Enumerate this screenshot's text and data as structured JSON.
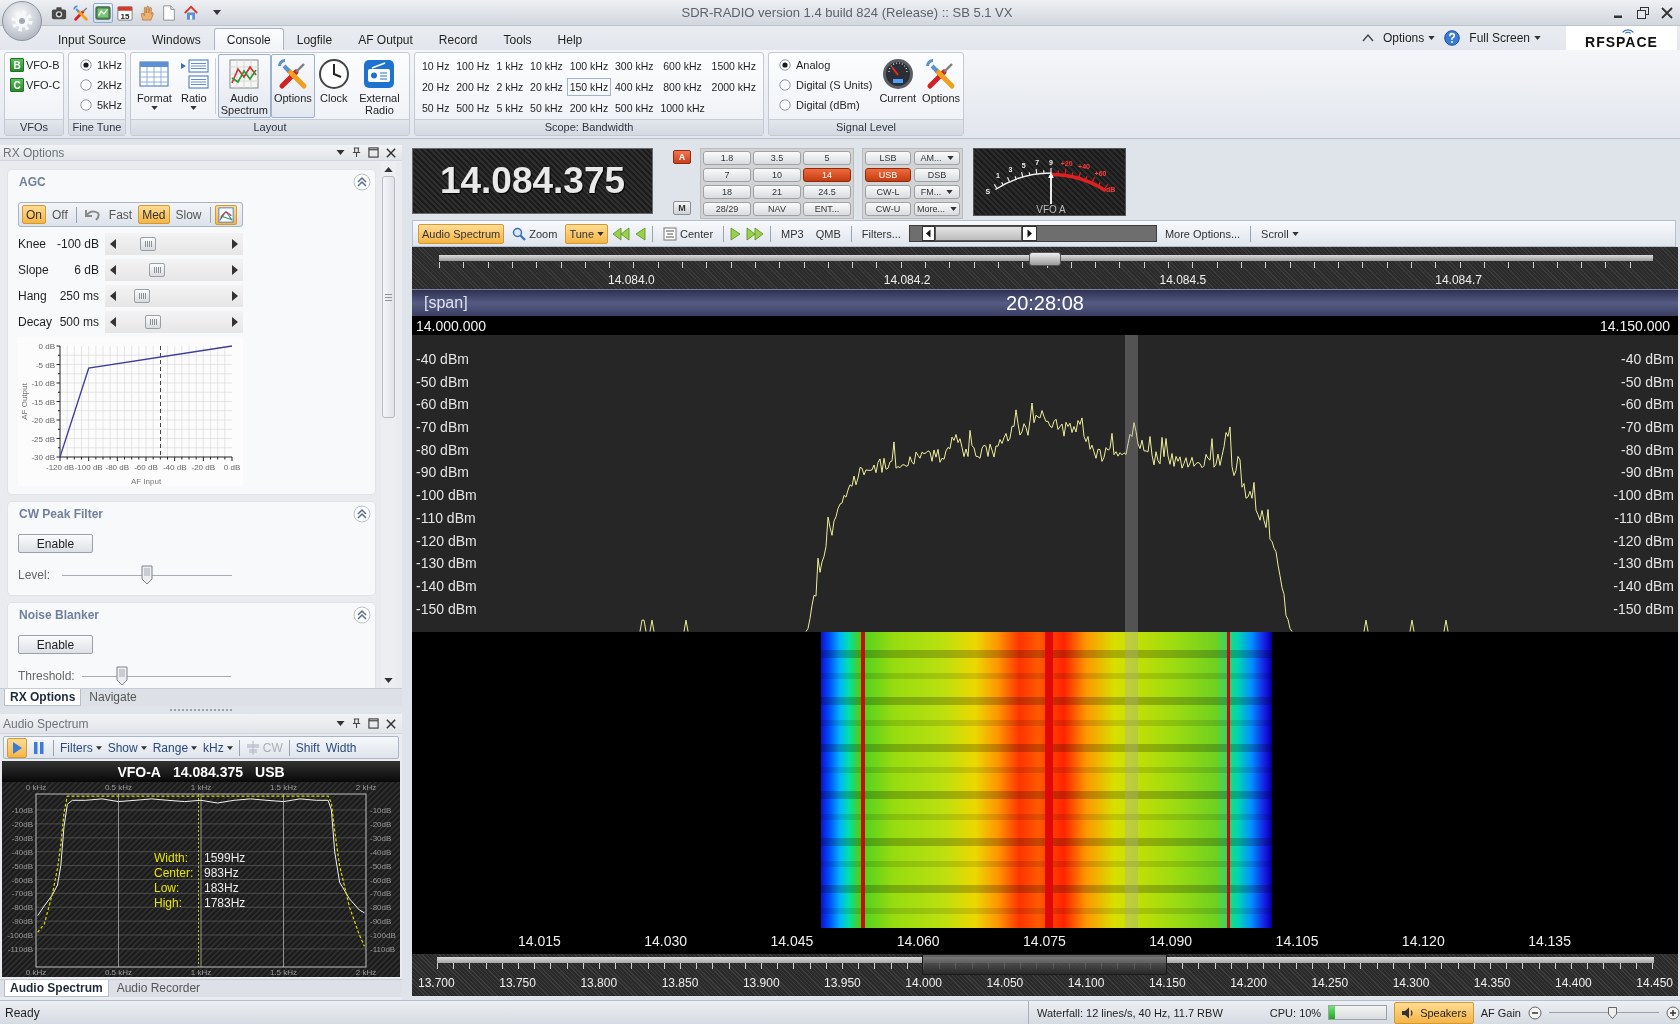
{
  "window": {
    "title": "SDR-RADIO version 1.4 build 824 (Release) :: SB 5.1 VX"
  },
  "quick_access": {
    "buttons": [
      {
        "selected": false
      },
      {
        "selected": false
      },
      {
        "selected": true
      },
      {
        "selected": false
      },
      {
        "selected": false
      },
      {
        "selected": false
      },
      {
        "selected": false
      }
    ],
    "calendar_day": "15"
  },
  "ribbon_tabs": [
    {
      "label": "Input Source",
      "selected": false
    },
    {
      "label": "Windows",
      "selected": false
    },
    {
      "label": "Console",
      "selected": true
    },
    {
      "label": "Logfile",
      "selected": false
    },
    {
      "label": "AF Output",
      "selected": false
    },
    {
      "label": "Record",
      "selected": false
    },
    {
      "label": "Tools",
      "selected": false
    },
    {
      "label": "Help",
      "selected": false
    }
  ],
  "ribbon_menus": [
    {
      "label": "Options"
    },
    {
      "label": "Full Screen"
    }
  ],
  "logo": {
    "text": "RFSPACE"
  },
  "ribbon": {
    "vfos": {
      "label": "VFOs",
      "items": [
        {
          "badge": "B",
          "label": "VFO-B"
        },
        {
          "badge": "C",
          "label": "VFO-C"
        }
      ]
    },
    "fine_tune": {
      "label": "Fine Tune",
      "options": [
        {
          "label": "1kHz",
          "selected": true
        },
        {
          "label": "2kHz",
          "selected": false
        },
        {
          "label": "5kHz",
          "selected": false
        }
      ]
    },
    "layout": {
      "label": "Layout",
      "buttons": [
        {
          "label": "Format",
          "dropdown": true,
          "selected": false
        },
        {
          "label": "Ratio",
          "dropdown": true,
          "selected": false
        },
        {
          "label": "Audio Spectrum",
          "dropdown": false,
          "selected": true
        },
        {
          "label": "Options",
          "dropdown": false,
          "selected": true
        },
        {
          "label": "Clock",
          "dropdown": false,
          "selected": false
        },
        {
          "label": "External Radio",
          "dropdown": false,
          "selected": false
        }
      ]
    },
    "scope_bandwidth": {
      "label": "Scope: Bandwidth",
      "rows": [
        [
          {
            "label": "10 Hz",
            "selected": false
          },
          {
            "label": "100 Hz",
            "selected": false
          },
          {
            "label": "1 kHz",
            "selected": false
          },
          {
            "label": "10 kHz",
            "selected": false
          },
          {
            "label": "100 kHz",
            "selected": false
          },
          {
            "label": "300 kHz",
            "selected": false
          },
          {
            "label": "600 kHz",
            "selected": false
          },
          {
            "label": "1500 kHz",
            "selected": false
          }
        ],
        [
          {
            "label": "20 Hz",
            "selected": false
          },
          {
            "label": "200 Hz",
            "selected": false
          },
          {
            "label": "2 kHz",
            "selected": false
          },
          {
            "label": "20 kHz",
            "selected": false
          },
          {
            "label": "150 kHz",
            "selected": true
          },
          {
            "label": "400 kHz",
            "selected": false
          },
          {
            "label": "800 kHz",
            "selected": false
          },
          {
            "label": "2000 kHz",
            "selected": false
          }
        ],
        [
          {
            "label": "50 Hz",
            "selected": false
          },
          {
            "label": "500 Hz",
            "selected": false
          },
          {
            "label": "5 kHz",
            "selected": false
          },
          {
            "label": "50 kHz",
            "selected": false
          },
          {
            "label": "200 kHz",
            "selected": false
          },
          {
            "label": "500 kHz",
            "selected": false
          },
          {
            "label": "1000 kHz",
            "selected": false
          }
        ]
      ]
    },
    "signal_level": {
      "label": "Signal Level",
      "options": [
        {
          "label": "Analog",
          "selected": true
        },
        {
          "label": "Digital (S Units)",
          "selected": false
        },
        {
          "label": "Digital (dBm)",
          "selected": false
        }
      ],
      "buttons": [
        {
          "label": "Current"
        },
        {
          "label": "Options"
        }
      ]
    }
  },
  "rx_options": {
    "title": "RX Options",
    "agc": {
      "title": "AGC",
      "expanded": true,
      "toolbar": [
        {
          "kind": "toggle",
          "label": "On",
          "selected": true
        },
        {
          "kind": "toggle",
          "label": "Off",
          "selected": false
        },
        {
          "kind": "separator"
        },
        {
          "kind": "icon",
          "selected": false
        },
        {
          "kind": "toggle",
          "label": "Fast",
          "selected": false
        },
        {
          "kind": "toggle",
          "label": "Med",
          "selected": true
        },
        {
          "kind": "toggle",
          "label": "Slow",
          "selected": false
        },
        {
          "kind": "separator"
        },
        {
          "kind": "icon",
          "selected": true
        }
      ],
      "sliders": [
        {
          "label": "Knee",
          "value": "-100 dB",
          "level": 0.26
        },
        {
          "label": "Slope",
          "value": "6 dB",
          "level": 0.34
        },
        {
          "label": "Hang",
          "value": "250 ms",
          "level": 0.2
        },
        {
          "label": "Decay",
          "value": "500 ms",
          "level": 0.3
        }
      ],
      "chart_data": {
        "type": "line",
        "xlabel": "AF Input",
        "ylabel": "AF Output",
        "x": [
          -120,
          -100,
          0
        ],
        "series": [
          {
            "color": "#3c3ca0",
            "values": [
              -30,
              -6,
              0
            ]
          }
        ],
        "xlim": [
          -120,
          0
        ],
        "ylim": [
          -30,
          0
        ],
        "xticks": [
          {
            "value": -120,
            "label": "-120 dB"
          },
          {
            "value": -100,
            "label": "-100 dB"
          },
          {
            "value": -80,
            "label": "-80 dB"
          },
          {
            "value": -60,
            "label": "-60 dB"
          },
          {
            "value": -40,
            "label": "-40 dB"
          },
          {
            "value": -20,
            "label": "-20 dB"
          },
          {
            "value": 0,
            "label": "0 dB"
          }
        ],
        "yticks": [
          {
            "value": 0,
            "label": "0 dB"
          },
          {
            "value": -5,
            "label": "-5 dB"
          },
          {
            "value": -10,
            "label": "-10 dB"
          },
          {
            "value": -15,
            "label": "-15 dB"
          },
          {
            "value": -20,
            "label": "-20 dB"
          },
          {
            "value": -25,
            "label": "-25 dB"
          },
          {
            "value": -30,
            "label": "-30 dB"
          }
        ],
        "grid": true,
        "ref_lines": [
          {
            "axis": "x",
            "value": -50,
            "line_style": "dashed"
          }
        ]
      }
    },
    "cw_peak_filter": {
      "title": "CW Peak Filter",
      "expanded": true,
      "button": "Enable",
      "slider": {
        "label": "Level:",
        "level": 0.5
      }
    },
    "noise_blanker": {
      "title": "Noise Blanker",
      "expanded": true,
      "button": "Enable",
      "slider": {
        "label": "Threshold:",
        "level": 0.25
      }
    },
    "tabs": [
      {
        "label": "RX Options",
        "selected": true
      },
      {
        "label": "Navigate",
        "selected": false
      }
    ]
  },
  "audio_spectrum": {
    "title": "Audio Spectrum",
    "transport": [
      {
        "selected": true
      },
      {
        "selected": false
      }
    ],
    "menus": [
      {
        "label": "Filters"
      },
      {
        "label": "Show"
      },
      {
        "label": "Range"
      },
      {
        "label": "kHz"
      }
    ],
    "cw": {
      "label": "CW",
      "disabled": true
    },
    "buttons": [
      {
        "label": "Shift"
      },
      {
        "label": "Width"
      }
    ],
    "header": {
      "vfo": "VFO-A",
      "frequency": "14.084.375",
      "mode": "USB"
    },
    "x_labels_top": [
      "0 kHz",
      "0.5 kHz",
      "1 kHz",
      "1.5 kHz",
      "2 kHz"
    ],
    "y_labels_right": [
      "-10dB",
      "-20dB",
      "-30dB",
      "-40dB",
      "-50dB",
      "-60dB",
      "-70dB",
      "-80dB",
      "-90dB",
      "-100dB",
      "-110dB"
    ],
    "chart_data": {
      "type": "line",
      "x": [
        0.01,
        0.05,
        0.1,
        0.13,
        0.15,
        0.17,
        0.19,
        0.22,
        0.3,
        0.4,
        0.5,
        0.6,
        0.7,
        0.8,
        0.9,
        1.0,
        1.1,
        1.2,
        1.3,
        1.4,
        1.5,
        1.6,
        1.7,
        1.77,
        1.79,
        1.81,
        1.84,
        1.9,
        1.96,
        1.99
      ],
      "series": [
        {
          "color": "#f2f2f2",
          "values": [
            -86,
            -79,
            -71,
            -64,
            -50,
            -22,
            -6,
            -3,
            -3,
            -2,
            -4,
            -3,
            -2,
            -3,
            -4,
            -3,
            -5,
            -3,
            -2,
            -3,
            -4,
            -2,
            -3,
            -3,
            -10,
            -40,
            -62,
            -74,
            -82,
            -84
          ]
        },
        {
          "color": "#d8d800",
          "line_style": "dashed",
          "values": [
            -98,
            -92,
            -70,
            -52,
            -35,
            -12,
            0,
            0,
            0,
            0,
            0,
            0,
            0,
            0,
            0,
            0,
            0,
            0,
            0,
            0,
            0,
            0,
            0,
            0,
            -5,
            -25,
            -50,
            -80,
            -100,
            -108
          ]
        }
      ],
      "xlim": [
        0,
        2
      ],
      "ylim": [
        -123,
        1.5
      ],
      "xticks": [
        {
          "value": 0,
          "label": "0 kHz"
        },
        {
          "value": 0.5,
          "label": "0.5 kHz"
        },
        {
          "value": 1,
          "label": "1 kHz"
        },
        {
          "value": 1.5,
          "label": "1.5 kHz"
        },
        {
          "value": 2,
          "label": "2 kHz"
        }
      ],
      "yticks": [
        {
          "value": -10,
          "label": "-10dB"
        },
        {
          "value": -20,
          "label": "-20dB"
        },
        {
          "value": -30,
          "label": "-30dB"
        },
        {
          "value": -40,
          "label": "-40dB"
        },
        {
          "value": -50,
          "label": "-50dB"
        },
        {
          "value": -60,
          "label": "-60dB"
        },
        {
          "value": -70,
          "label": "-70dB"
        },
        {
          "value": -80,
          "label": "-80dB"
        },
        {
          "value": -90,
          "label": "-90dB"
        },
        {
          "value": -100,
          "label": "-100dB"
        },
        {
          "value": -110,
          "label": "-110dB"
        }
      ],
      "grid": true,
      "ref_lines": [
        {
          "axis": "x",
          "value": 0.983,
          "line_style": "dashed"
        }
      ]
    },
    "readouts": [
      {
        "label": "Width:",
        "value": "1599Hz"
      },
      {
        "label": "Center:",
        "value": "983Hz"
      },
      {
        "label": "Low:",
        "value": "183Hz"
      },
      {
        "label": "High:",
        "value": "1783Hz"
      }
    ],
    "tabs": [
      {
        "label": "Audio Spectrum",
        "selected": true
      },
      {
        "label": "Audio Recorder",
        "selected": false
      }
    ]
  },
  "vfo_display": {
    "frequency": "14.084.375",
    "vfo_button": {
      "label": "A",
      "selected": true
    },
    "memory_button": {
      "label": "M"
    }
  },
  "band_buttons": [
    {
      "label": "1.8",
      "selected": false
    },
    {
      "label": "3.5",
      "selected": false
    },
    {
      "label": "5",
      "selected": false
    },
    {
      "label": "7",
      "selected": false
    },
    {
      "label": "10",
      "selected": false
    },
    {
      "label": "14",
      "selected": true
    },
    {
      "label": "18",
      "selected": false
    },
    {
      "label": "21",
      "selected": false
    },
    {
      "label": "24.5",
      "selected": false
    },
    {
      "label": "28/29",
      "selected": false
    },
    {
      "label": "NAV",
      "selected": false
    },
    {
      "label": "ENT...",
      "selected": false
    }
  ],
  "mode_buttons": [
    {
      "label": "LSB",
      "selected": false,
      "dropdown": false
    },
    {
      "label": "AM...",
      "selected": false,
      "dropdown": true
    },
    {
      "label": "USB",
      "selected": true,
      "dropdown": false
    },
    {
      "label": "DSB",
      "selected": false,
      "dropdown": false
    },
    {
      "label": "CW-L",
      "selected": false,
      "dropdown": false
    },
    {
      "label": "FM...",
      "selected": false,
      "dropdown": true
    },
    {
      "label": "CW-U",
      "selected": false,
      "dropdown": false
    },
    {
      "label": "More...",
      "selected": false,
      "dropdown": true
    }
  ],
  "s_meter": {
    "scale": [
      "S",
      "1",
      "3",
      "5",
      "7",
      "9",
      "+20",
      "+40",
      "+60",
      "dB"
    ],
    "label": "VFO A",
    "level": 0.5
  },
  "spectrum_toolbar": {
    "audio_spectrum": {
      "label": "Audio Spectrum",
      "selected": true
    },
    "zoom": {
      "label": "Zoom"
    },
    "tune": {
      "label": "Tune",
      "selected": true
    },
    "center": {
      "label": "Center"
    },
    "mp3": {
      "label": "MP3"
    },
    "qmb": {
      "label": "QMB"
    },
    "filters": {
      "label": "Filters..."
    },
    "more_options": {
      "label": "More Options..."
    },
    "scroll": {
      "label": "Scroll"
    }
  },
  "ruler": {
    "labels": [
      "14.084.0",
      "14.084.2",
      "14.084.5",
      "14.084.7"
    ]
  },
  "span_bar": {
    "span": "[span]",
    "time": "20:28:08"
  },
  "range_bar": {
    "start": "14.000.000",
    "end": "14.150.000"
  },
  "spectrum": {
    "labels_left": [
      "-40 dBm",
      "-50 dBm",
      "-60 dBm",
      "-70 dBm",
      "-80 dBm",
      "-90 dBm",
      "-100 dBm",
      "-110 dBm",
      "-120 dBm",
      "-130 dBm",
      "-140 dBm",
      "-150 dBm"
    ],
    "labels_right": [
      "-40 dBm",
      "-50 dBm",
      "-60 dBm",
      "-70 dBm",
      "-80 dBm",
      "-90 dBm",
      "-100 dBm",
      "-110 dBm",
      "-120 dBm",
      "-130 dBm",
      "-140 dBm",
      "-150 dBm"
    ]
  },
  "frequency_axis": {
    "labels": [
      "14.015",
      "14.030",
      "14.045",
      "14.060",
      "14.075",
      "14.090",
      "14.105",
      "14.120",
      "14.135"
    ]
  },
  "overview": {
    "labels": [
      "13.700",
      "13.750",
      "13.800",
      "13.850",
      "13.900",
      "13.950",
      "14.000",
      "14.050",
      "14.100",
      "14.150",
      "14.200",
      "14.250",
      "14.300",
      "14.350",
      "14.400",
      "14.450"
    ]
  },
  "status_bar": {
    "text": "Ready",
    "waterfall": "Waterfall: 12 lines/s, 40 Hz, 11.7 RBW",
    "cpu": {
      "label": "CPU: 10%",
      "level": 0.1
    },
    "speakers": {
      "label": "Speakers",
      "selected": true
    },
    "af_gain": {
      "label": "AF Gain",
      "level": 0.58
    }
  }
}
